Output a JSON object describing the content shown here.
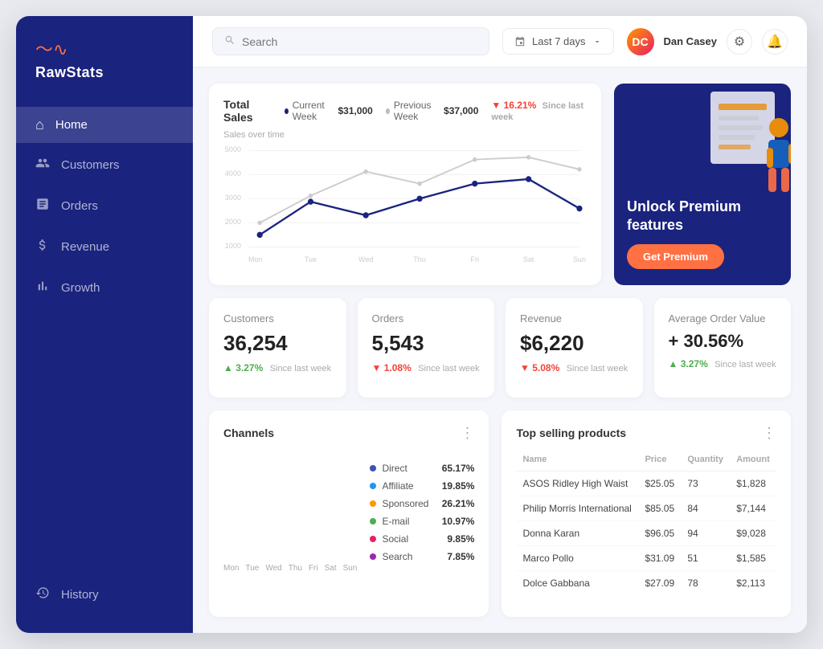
{
  "app": {
    "name": "RawStats"
  },
  "header": {
    "search_placeholder": "Search",
    "date_filter": "Last 7 days",
    "user_name": "Dan Casey",
    "user_initials": "DC"
  },
  "sidebar": {
    "items": [
      {
        "id": "home",
        "label": "Home",
        "icon": "⌂",
        "active": true
      },
      {
        "id": "customers",
        "label": "Customers",
        "icon": "👤",
        "active": false
      },
      {
        "id": "orders",
        "label": "Orders",
        "icon": "📋",
        "active": false
      },
      {
        "id": "revenue",
        "label": "Revenue",
        "icon": "📊",
        "active": false
      },
      {
        "id": "growth",
        "label": "Growth",
        "icon": "📈",
        "active": false
      }
    ],
    "bottom_items": [
      {
        "id": "history",
        "label": "History",
        "icon": "🕐",
        "active": false
      }
    ]
  },
  "sales_chart": {
    "title": "Total Sales",
    "current_week_label": "Current Week",
    "current_week_value": "$31,000",
    "previous_week_label": "Previous Week",
    "previous_week_value": "$37,000",
    "change_value": "▼ 16.21%",
    "change_since": "Since last week",
    "chart_label": "Sales over time",
    "days": [
      "Mon",
      "Tue",
      "Wed",
      "Thu",
      "Fri",
      "Sat",
      "Sun"
    ],
    "y_labels": [
      "5000",
      "4000",
      "3000",
      "2000",
      "1000"
    ],
    "current_data": [
      1500,
      2800,
      2200,
      3100,
      3600,
      3800,
      2400
    ],
    "previous_data": [
      2000,
      3200,
      4200,
      3600,
      4800,
      4900,
      4100
    ]
  },
  "premium": {
    "text": "Unlock Premium features",
    "button_label": "Get Premium"
  },
  "stats": [
    {
      "label": "Customers",
      "value": "36,254",
      "change": "▲ 3.27%",
      "change_dir": "up",
      "since": "Since last week"
    },
    {
      "label": "Orders",
      "value": "5,543",
      "change": "▼ 1.08%",
      "change_dir": "down",
      "since": "Since last week"
    },
    {
      "label": "Revenue",
      "value": "$6,220",
      "change": "▼ 5.08%",
      "change_dir": "down",
      "since": "Since last week"
    },
    {
      "label": "Average Order Value",
      "value": "+ 30.56%",
      "change": "▲ 3.27%",
      "change_dir": "up",
      "since": "Since last week"
    }
  ],
  "channels": {
    "title": "Channels",
    "days": [
      "Mon",
      "Tue",
      "Wed",
      "Thu",
      "Fri",
      "Sat",
      "Sun"
    ],
    "legend": [
      {
        "name": "Direct",
        "color": "#3f51b5",
        "pct": "65.17%"
      },
      {
        "name": "Affiliate",
        "color": "#2196f3",
        "pct": "19.85%"
      },
      {
        "name": "Sponsored",
        "color": "#ff9800",
        "pct": "26.21%"
      },
      {
        "name": "E-mail",
        "color": "#4caf50",
        "pct": "10.97%"
      },
      {
        "name": "Social",
        "color": "#e91e63",
        "pct": "9.85%"
      },
      {
        "name": "Search",
        "color": "#9c27b0",
        "pct": "7.85%"
      }
    ]
  },
  "products": {
    "title": "Top selling products",
    "columns": [
      "Name",
      "Price",
      "Quantity",
      "Amount"
    ],
    "rows": [
      {
        "name": "ASOS Ridley High Waist",
        "price": "$25.05",
        "qty": "73",
        "amount": "$1,828"
      },
      {
        "name": "Philip Morris International",
        "price": "$85.05",
        "qty": "84",
        "amount": "$7,144"
      },
      {
        "name": "Donna Karan",
        "price": "$96.05",
        "qty": "94",
        "amount": "$9,028"
      },
      {
        "name": "Marco Pollo",
        "price": "$31.09",
        "qty": "51",
        "amount": "$1,585"
      },
      {
        "name": "Dolce Gabbana",
        "price": "$27.09",
        "qty": "78",
        "amount": "$2,113"
      }
    ]
  }
}
